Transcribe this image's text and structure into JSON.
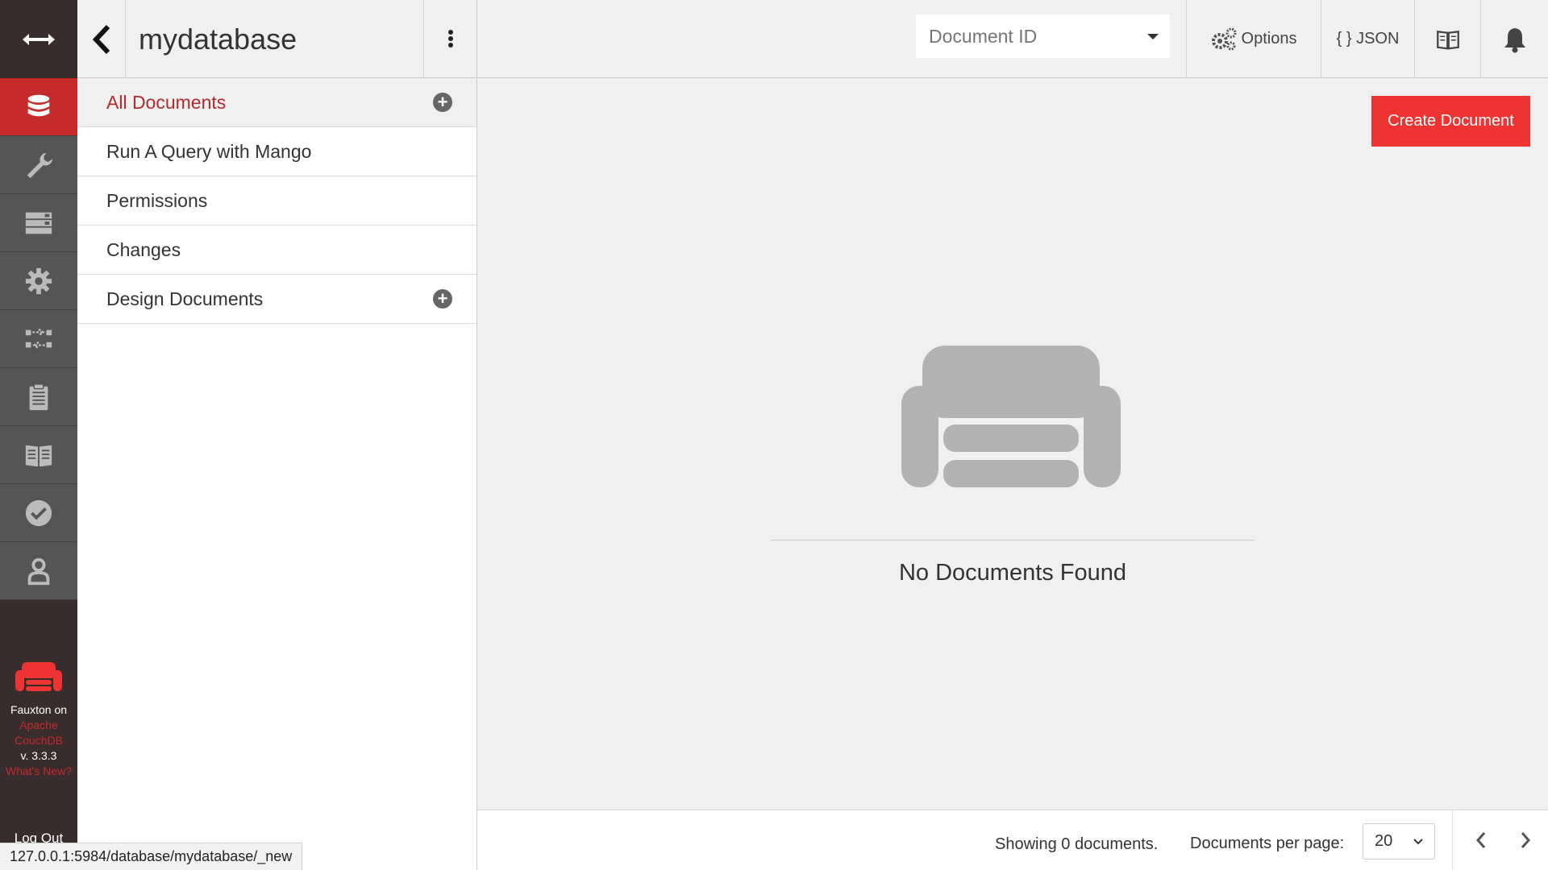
{
  "database": {
    "name": "mydatabase"
  },
  "sidebar": {
    "items": [
      {
        "label": "All Documents"
      },
      {
        "label": "Run A Query with Mango"
      },
      {
        "label": "Permissions"
      },
      {
        "label": "Changes"
      },
      {
        "label": "Design Documents"
      }
    ]
  },
  "topbar": {
    "doc_id_placeholder": "Document ID",
    "options_label": "Options",
    "json_label": "{ } JSON"
  },
  "main": {
    "create_label": "Create Document",
    "empty_text": "No Documents Found"
  },
  "footer": {
    "showing": "Showing 0 documents.",
    "per_page_label": "Documents per page:",
    "per_page_value": "20"
  },
  "rail": {
    "fauxton_on": "Fauxton on",
    "apache": "Apache",
    "couchdb": "CouchDB",
    "version": "v. 3.3.3",
    "whats_new": "What's New?",
    "logout": "Log Out"
  },
  "status_url": "127.0.0.1:5984/database/mydatabase/_new",
  "colors": {
    "accent": "#c52b2b",
    "create_button": "#ee3333",
    "rail_bg": "#382c2c",
    "rail_item": "#555555"
  }
}
